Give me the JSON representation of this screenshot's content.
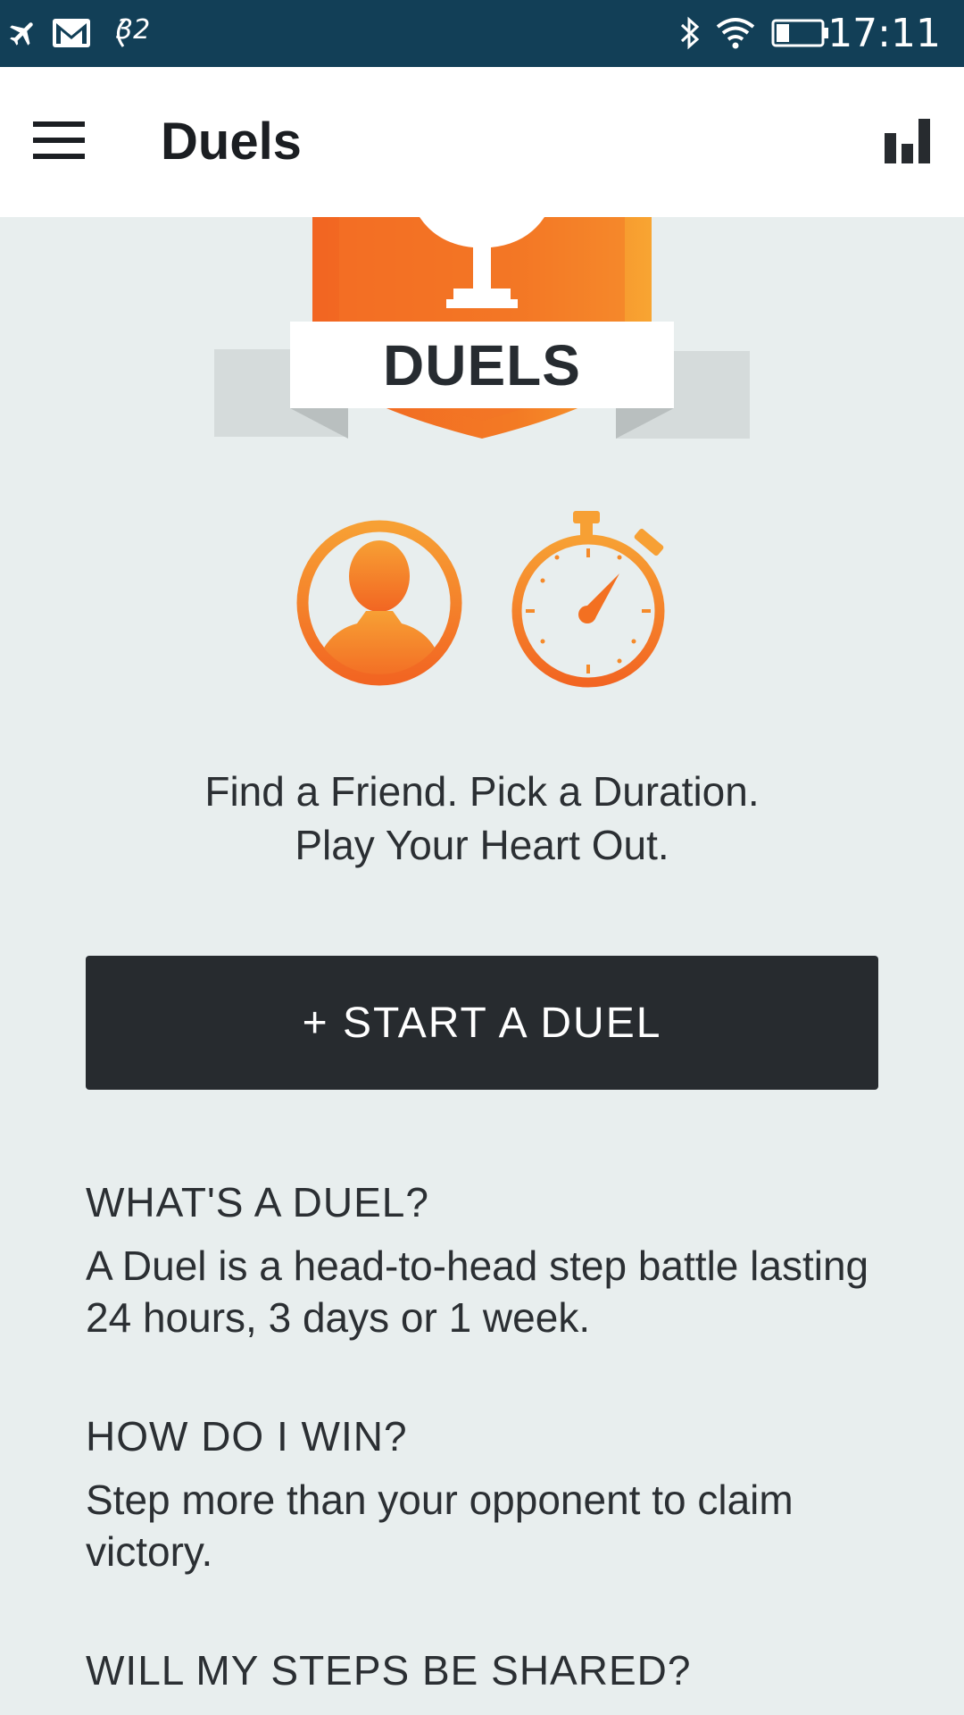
{
  "status_bar": {
    "signal_number": "32",
    "time": "17:11",
    "icons": [
      "airplane-icon",
      "gmail-icon",
      "signal-icon",
      "bluetooth-icon",
      "wifi-icon",
      "battery-icon"
    ]
  },
  "app_bar": {
    "title": "Duels",
    "menu_icon": "hamburger-menu-icon",
    "stats_icon": "bar-chart-icon"
  },
  "hero": {
    "label": "DUELS",
    "colors": {
      "shield": "#f37021",
      "shield_light": "#f7a034",
      "ribbon": "#d6dcdc"
    }
  },
  "icons": {
    "friend": "person-icon",
    "duration": "stopwatch-icon",
    "accent": "#f58a2a"
  },
  "tagline": {
    "line1": "Find a Friend. Pick a Duration.",
    "line2": "Play Your Heart Out."
  },
  "start_button": {
    "label": "+ START A DUEL"
  },
  "faq": [
    {
      "question": "WHAT'S A DUEL?",
      "answer": "A Duel is a head-to-head step battle lasting 24 hours, 3 days or 1 week."
    },
    {
      "question": "HOW DO I WIN?",
      "answer": "Step more than your opponent to claim victory."
    },
    {
      "question": "WILL MY STEPS BE SHARED?",
      "answer": ""
    }
  ]
}
